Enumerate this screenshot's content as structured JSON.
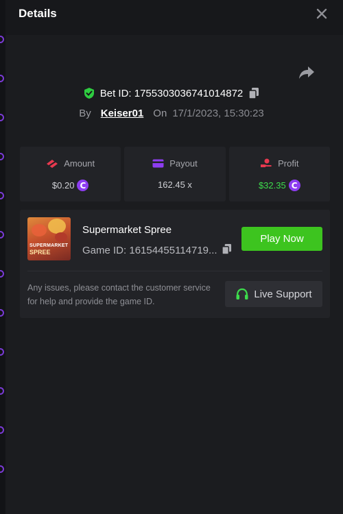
{
  "header": {
    "title": "Details"
  },
  "bet": {
    "id_text": "Bet ID: 1755303036741014872",
    "by_label": "By",
    "username": "Keiser01",
    "on_label": "On",
    "datetime": "17/1/2023, 15:30:23"
  },
  "stats": [
    {
      "label": "Amount",
      "value": "$0.20",
      "icon": "amount-icon",
      "color": "#e8394f",
      "has_coin": true
    },
    {
      "label": "Payout",
      "value": "162.45 x",
      "icon": "payout-card-icon",
      "color": "#8d3df0",
      "has_coin": false
    },
    {
      "label": "Profit",
      "value": "$32.35",
      "icon": "profit-hand-icon",
      "color": "#e8394f",
      "has_coin": true,
      "value_color": "#3ddc4c"
    }
  ],
  "coin_symbol": "C",
  "game": {
    "title": "Supermarket Spree",
    "id_text": "Game ID: 16154455114719...",
    "thumb_line1": "SUPERMARKET",
    "thumb_line2": "SPREE",
    "play_label": "Play Now"
  },
  "support": {
    "text": "Any issues, please contact the customer service for help and provide the game ID.",
    "button_label": "Live Support"
  },
  "colors": {
    "accent_green": "#3dc41f",
    "profit_green": "#3ddc4c",
    "coin_purple": "#8d3df0",
    "shield_green": "#2ecc40"
  }
}
